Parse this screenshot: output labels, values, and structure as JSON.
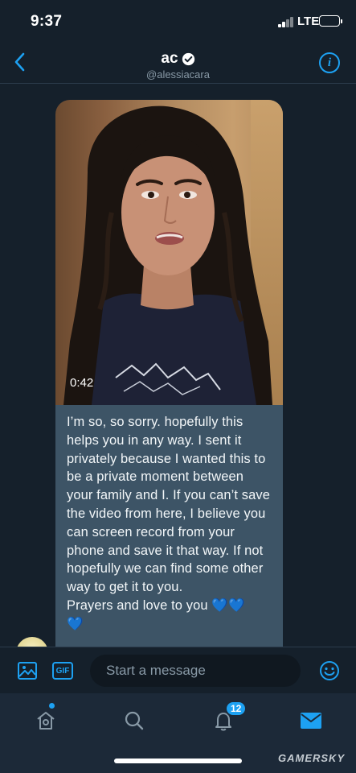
{
  "status_bar": {
    "time": "9:37",
    "network": "LTE",
    "battery_color": "#f5c518"
  },
  "header": {
    "name": "ac",
    "handle": "@alessiacara",
    "verified": true,
    "info_glyph": "i",
    "back_icon": "chevron-left-icon"
  },
  "conversation": {
    "video": {
      "duration": "0:42"
    },
    "message": {
      "text": "I’m so, so sorry. hopefully this helps you in any way. I sent it privately because I wanted this to be a private moment between your family and I. If you can’t save the video from here, I believe you can screen record from your phone and save it that way. If not hopefully we can find some other way to get it to you.",
      "closing": "Prayers and love to you ",
      "hearts": "💙💙",
      "partial_line": "💙"
    }
  },
  "composer": {
    "placeholder": "Start a message",
    "gif_label": "GIF",
    "media_icon": "image-icon",
    "emoji_icon": "smiley-icon"
  },
  "tabbar": {
    "tabs": [
      {
        "name": "home",
        "icon": "home-icon"
      },
      {
        "name": "search",
        "icon": "search-icon"
      },
      {
        "name": "notifications",
        "icon": "bell-icon"
      },
      {
        "name": "messages",
        "icon": "envelope-icon"
      }
    ],
    "notifications_badge": "12"
  },
  "watermark": "GAMERSKY",
  "colors": {
    "accent": "#1da1f2",
    "background": "#15202b",
    "bubble": "#3d5466",
    "tabbar": "#1c2938"
  }
}
